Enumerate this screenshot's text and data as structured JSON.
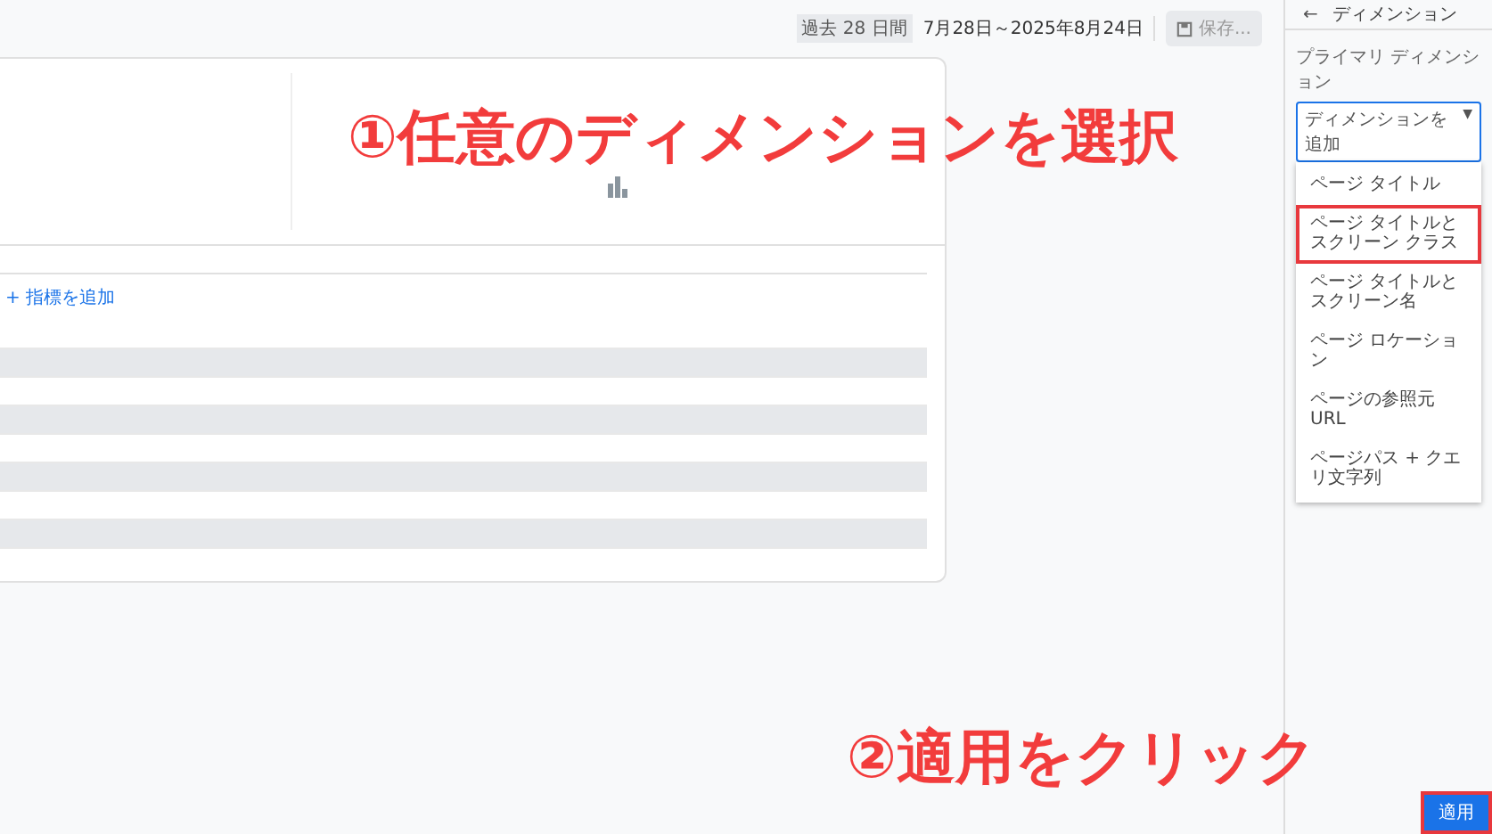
{
  "toolbar": {
    "date_range_badge": "過去 28 日間",
    "date_range": "7月28日～2025年8月24日",
    "save_button": {
      "label": "保存...",
      "disabled": true
    }
  },
  "report": {
    "add_metric": "+ 指標を追加",
    "rows": [
      {
        "shaded": false
      },
      {
        "shaded": true
      },
      {
        "shaded": false
      },
      {
        "shaded": true
      },
      {
        "shaded": false
      },
      {
        "shaded": true
      },
      {
        "shaded": false
      },
      {
        "shaded": true
      }
    ]
  },
  "panel": {
    "title": "ディメンション",
    "back": "←",
    "field_label": "プライマリ ディメンション",
    "select": {
      "placeholder": "ディメンションを追加",
      "caret": "▼"
    },
    "options": [
      {
        "label": "ページ タイトル",
        "highlighted": false
      },
      {
        "label": "ページ タイトルとスクリーン クラス",
        "highlighted": true
      },
      {
        "label": "ページ タイトルとスクリーン名",
        "highlighted": false
      },
      {
        "label": "ページ ロケーション",
        "highlighted": false
      },
      {
        "label": "ページの参照元 URL",
        "highlighted": false
      },
      {
        "label": "ページパス + クエリ文字列",
        "highlighted": false
      }
    ],
    "apply_button": {
      "label": "適用",
      "highlighted": true
    }
  },
  "annotations": [
    "①任意のディメンションを選択",
    "②適用をクリック"
  ]
}
